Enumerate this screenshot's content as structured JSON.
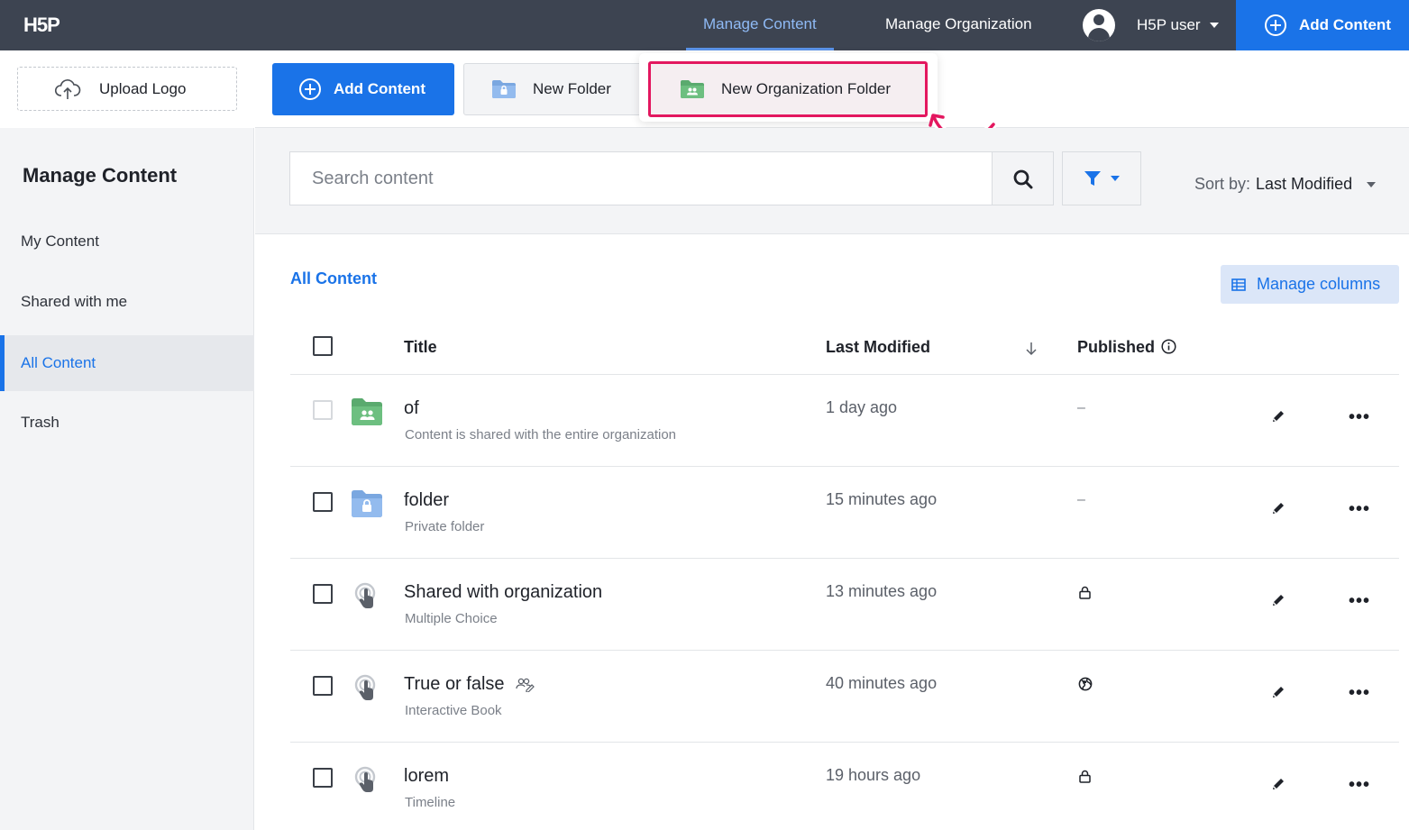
{
  "colors": {
    "topbar": "#3d4451",
    "primary": "#1a73e8",
    "highlight": "#e3175f",
    "sidebar": "#f3f4f6"
  },
  "topbar": {
    "logo": "H5P",
    "nav": [
      {
        "label": "Manage Content",
        "active": true
      },
      {
        "label": "Manage Organization",
        "active": false
      }
    ],
    "user_name": "H5P user",
    "add_content_label": "Add Content"
  },
  "sidebar": {
    "upload_logo_label": "Upload Logo",
    "title": "Manage Content",
    "items": [
      {
        "label": "My Content",
        "active": false
      },
      {
        "label": "Shared with me",
        "active": false
      },
      {
        "label": "All Content",
        "active": true
      },
      {
        "label": "Trash",
        "active": false
      }
    ]
  },
  "toolbar": {
    "add_content_label": "Add Content",
    "new_folder_label": "New Folder",
    "new_org_folder_label": "New Organization Folder"
  },
  "search": {
    "placeholder": "Search content",
    "value": "",
    "sort_label": "Sort by:",
    "sort_value": "Last Modified"
  },
  "content": {
    "heading": "All Content",
    "manage_columns_label": "Manage columns",
    "columns": {
      "title": "Title",
      "last_modified": "Last Modified",
      "published": "Published"
    },
    "rows": [
      {
        "title": "of",
        "subtitle": "Content is shared with the entire organization",
        "modified": "1 day ago",
        "published": "–",
        "icon": "organization-folder-icon"
      },
      {
        "title": "folder",
        "subtitle": "Private folder",
        "modified": "15 minutes ago",
        "published": "–",
        "icon": "private-folder-icon"
      },
      {
        "title": "Shared with organization",
        "subtitle": "Multiple Choice",
        "modified": "13 minutes ago",
        "published": "lock-icon",
        "icon": "h5p-content-icon"
      },
      {
        "title": "True or false",
        "subtitle": "Interactive Book",
        "modified": "40 minutes ago",
        "published": "globe-icon",
        "icon": "h5p-content-icon",
        "shared_badge": "shared-users-icon"
      },
      {
        "title": "lorem",
        "subtitle": "Timeline",
        "modified": "19 hours ago",
        "published": "lock-icon",
        "icon": "h5p-content-icon"
      }
    ]
  }
}
